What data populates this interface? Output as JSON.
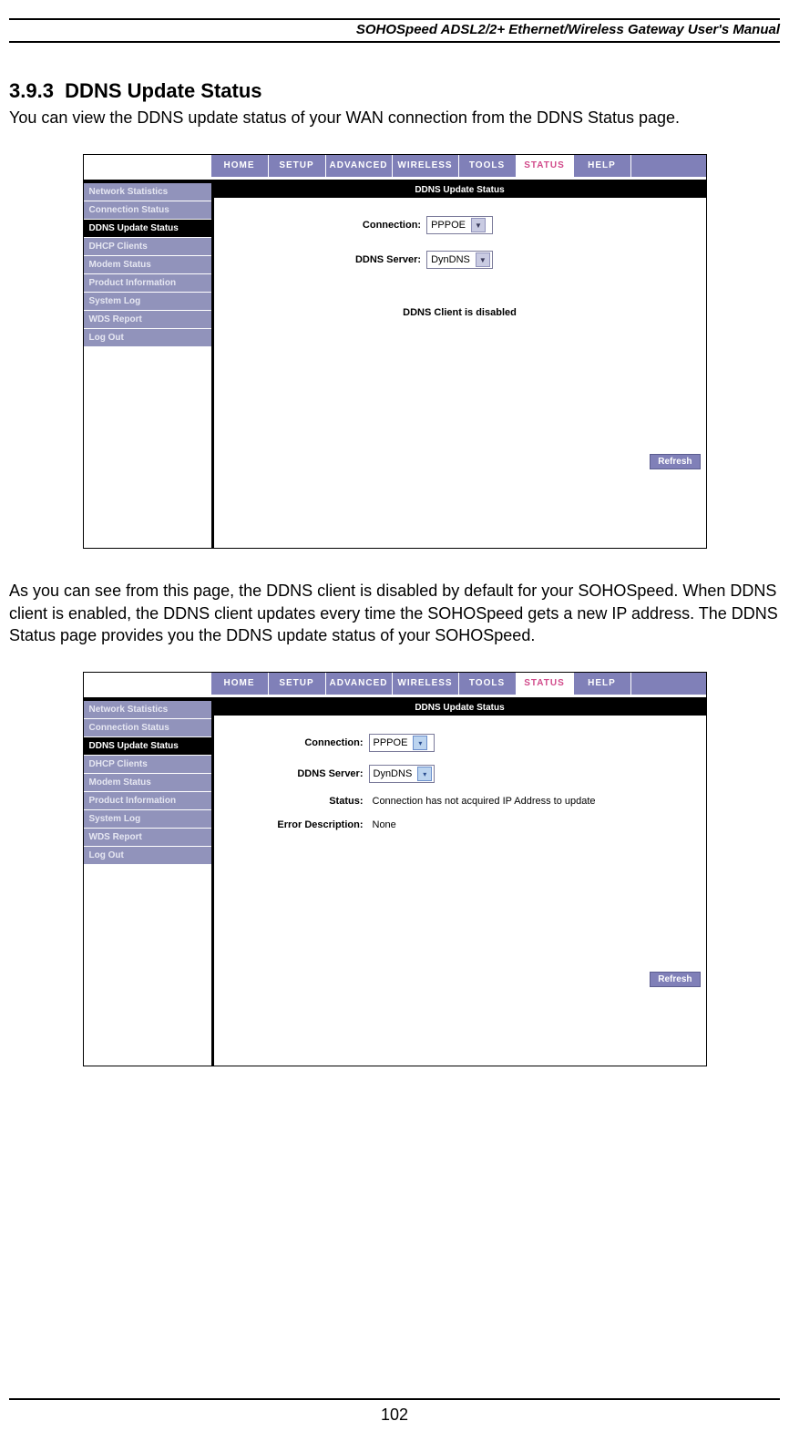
{
  "doc": {
    "manual_title": "SOHOSpeed ADSL2/2+ Ethernet/Wireless Gateway User's Manual",
    "section_number": "3.9.3",
    "section_title": "DDNS Update Status",
    "intro": "You can view the DDNS update status of your WAN connection from the DDNS Status page.",
    "para2": "As you can see from this page, the DDNS client is disabled by default for your SOHOSpeed. When DDNS client is enabled, the DDNS client updates every time the SOHOSpeed gets a new IP address. The DDNS Status page provides you the DDNS update status of your SOHOSpeed.",
    "page_number": "102"
  },
  "nav": {
    "home": "HOME",
    "setup": "SETUP",
    "advanced": "ADVANCED",
    "wireless": "WIRELESS",
    "tools": "TOOLS",
    "status": "STATUS",
    "help": "HELP"
  },
  "sidebar": {
    "items": [
      "Network Statistics",
      "Connection Status",
      "DDNS Update Status",
      "DHCP Clients",
      "Modem Status",
      "Product Information",
      "System Log",
      "WDS Report",
      "Log Out"
    ]
  },
  "panel": {
    "title": "DDNS Update Status",
    "connection_label": "Connection:",
    "connection_value": "PPPOE",
    "server_label": "DDNS Server:",
    "server_value": "DynDNS",
    "disabled_message": "DDNS Client is disabled",
    "status_label": "Status:",
    "status_value": "Connection has not acquired IP Address to update",
    "errdesc_label": "Error Description:",
    "errdesc_value": "None",
    "refresh": "Refresh"
  }
}
